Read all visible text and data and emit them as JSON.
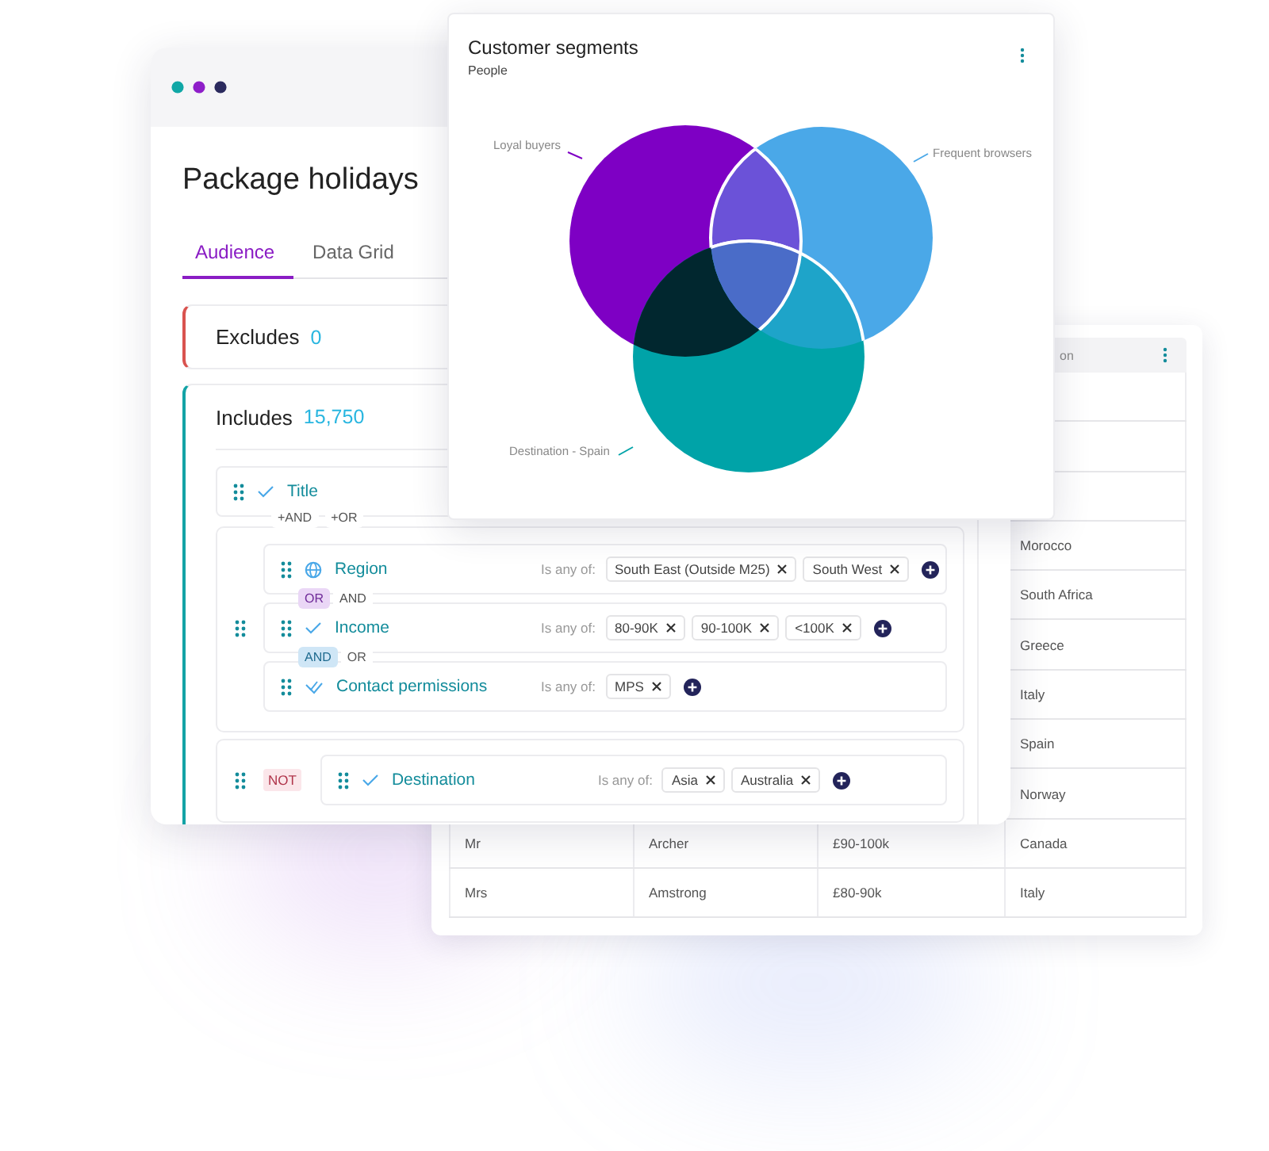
{
  "data_grid": {
    "header": "on",
    "rows": [
      {},
      {},
      {},
      {
        "column_4": "Morocco"
      },
      {
        "column_4": "South Africa"
      },
      {
        "column_4": "Greece"
      },
      {
        "column_4": "Italy"
      },
      {
        "column_4": "Spain"
      },
      {
        "column_4": "Norway"
      },
      {
        "column_1": "Mr",
        "column_2": "Archer",
        "column_3": "£90-100k",
        "column_4": "Canada"
      },
      {
        "column_1": "Mrs",
        "column_2": "Amstrong",
        "column_3": "£80-90k",
        "column_4": "Italy"
      }
    ]
  },
  "audience": {
    "title": "Package holidays",
    "tabs": [
      {
        "label": "Audience",
        "selected": true
      },
      {
        "label": "Data Grid",
        "selected": false
      }
    ],
    "excludes": {
      "label": "Excludes",
      "count": "0"
    },
    "includes": {
      "label": "Includes",
      "count": "15,750",
      "items": [
        {
          "kind": "rule",
          "field": {
            "label": "Title",
            "kind": "attribute"
          },
          "add_joins": [
            "+AND",
            "+OR"
          ]
        },
        {
          "kind": "group",
          "rules": [
            {
              "field": {
                "label": "Region",
                "kind": "location"
              },
              "condition": "Is any of:",
              "values": [
                "South East (Outside M25)",
                "South West"
              ]
            },
            {
              "joins": [
                {
                  "label": "OR",
                  "kind": "or",
                  "selected": true
                },
                {
                  "label": "AND",
                  "kind": "and",
                  "selected": false
                }
              ],
              "field": {
                "label": "Income",
                "kind": "attribute"
              },
              "condition": "Is any of:",
              "values": [
                "80-90K",
                "90-100K",
                "<100K"
              ]
            },
            {
              "joins": [
                {
                  "label": "AND",
                  "kind": "and",
                  "selected": true
                },
                {
                  "label": "OR",
                  "kind": "or",
                  "selected": false
                }
              ],
              "field": {
                "label": "Contact permissions",
                "kind": "consent"
              },
              "condition": "Is any of:",
              "values": [
                "MPS"
              ]
            }
          ]
        },
        {
          "kind": "negated",
          "badge": "NOT",
          "rules": [
            {
              "field": {
                "label": "Destination",
                "kind": "attribute"
              },
              "condition": "Is any of:",
              "values": [
                "Asia",
                "Australia"
              ]
            }
          ]
        }
      ]
    }
  },
  "segments_card": {
    "title": "Customer segments",
    "subtitle": "People",
    "segments": [
      {
        "label": "Loyal buyers",
        "color": "#7e00c4"
      },
      {
        "label": "Frequent browsers",
        "color": "#4aa8e8"
      },
      {
        "label": "Destination - Spain",
        "color": "#00a3a8"
      }
    ]
  }
}
